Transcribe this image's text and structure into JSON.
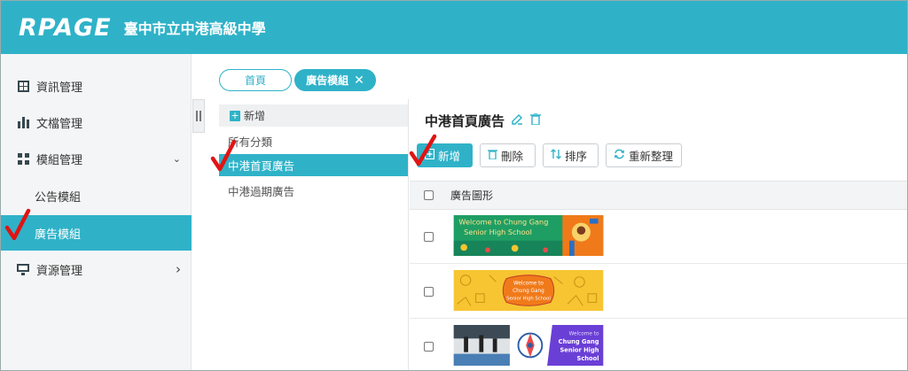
{
  "header": {
    "logo": "RPAGE",
    "school_name": "臺中市立中港高級中學"
  },
  "sidebar": {
    "items": [
      {
        "label": "資訊管理",
        "icon": "layout-icon"
      },
      {
        "label": "文檔管理",
        "icon": "bar-chart-icon"
      },
      {
        "label": "模組管理",
        "icon": "grid-icon",
        "arrow": "⌄"
      },
      {
        "label": "公告模組"
      },
      {
        "label": "廣告模組",
        "active": true
      },
      {
        "label": "資源管理",
        "icon": "monitor-icon",
        "arrow": "›"
      }
    ]
  },
  "tabs": [
    {
      "label": "首頁"
    },
    {
      "label": "廣告模組",
      "close": "✕"
    }
  ],
  "categories": {
    "add_label": "新增",
    "items": [
      {
        "label": "所有分類"
      },
      {
        "label": "中港首頁廣告",
        "active": true
      },
      {
        "label": "中港過期廣告"
      }
    ]
  },
  "main": {
    "title": "中港首頁廣告",
    "toolbar": {
      "add": "新增",
      "delete": "刪除",
      "sort": "排序",
      "refresh": "重新整理"
    },
    "table": {
      "header": "廣告圖形",
      "banners": [
        {
          "line1": "Welcome to Chung Gang",
          "line2": "Senior High School",
          "colors": {
            "bg": "#1f9e64",
            "accent": "#f07a1a",
            "text": "#ffe38a"
          }
        },
        {
          "line1": "Welcome to",
          "line2": "Chung Gang",
          "line3": "Senior High School",
          "colors": {
            "bg": "#f6c531",
            "accent": "#f07a1a",
            "text": "#c0392b"
          }
        },
        {
          "line1": "Welcome to",
          "line2": "Chung Gang",
          "line3": "Senior High",
          "line4": "School",
          "colors": {
            "bg": "#6a3fd6",
            "accent": "#ffffff",
            "text": "#ffffff"
          }
        }
      ]
    }
  },
  "colors": {
    "brand": "#2fb2c8",
    "annotation": "#e01414"
  }
}
